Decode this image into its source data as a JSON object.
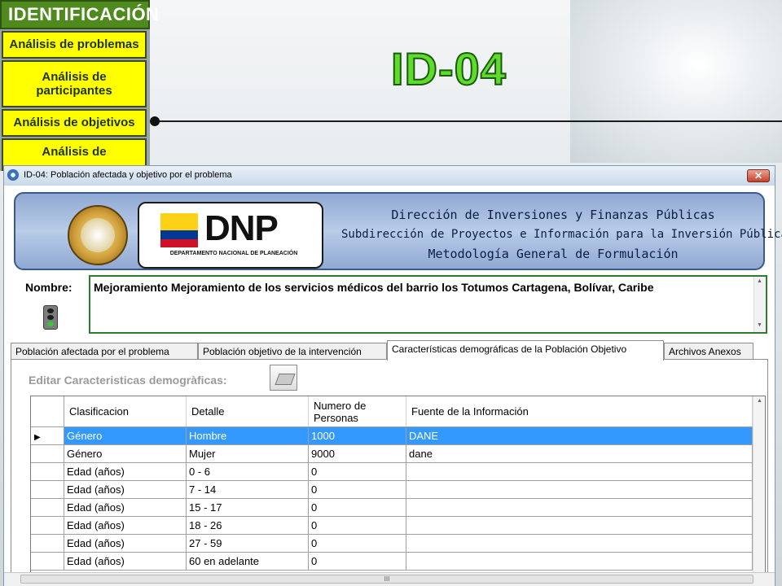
{
  "slide": {
    "id_title": "ID-04",
    "nav": {
      "title": "IDENTIFICACIÓN",
      "items": [
        "Análisis de problemas",
        "Análisis de participantes",
        "Análisis de objetivos",
        "Análisis de"
      ]
    }
  },
  "window": {
    "title": "ID-04: Población afectada y objetivo por el problema",
    "close_symbol": "✕"
  },
  "banner": {
    "seal_text": "REPÚBLICA DE COLOMBIA",
    "dnp_logo": "DNP",
    "dnp_subtitle": "DEPARTAMENTO NACIONAL DE PLANEACIÓN",
    "lines": [
      "Dirección de Inversiones y Finanzas Públicas",
      "Subdirección de Proyectos e Información para la Inversión Pública",
      "Metodología General de Formulación"
    ]
  },
  "nombre": {
    "label": "Nombre:",
    "value": "Mejoramiento Mejoramiento de los servicios médicos del barrio los Totumos Cartagena, Bolívar, Caribe"
  },
  "tabs": [
    {
      "label": "Población afectada por el problema",
      "active": false
    },
    {
      "label": "Población objetivo de la intervención",
      "active": false
    },
    {
      "label": "Características demográficas de la Población Objetivo",
      "active": true
    },
    {
      "label": "Archivos Anexos",
      "active": false
    }
  ],
  "edit": {
    "label": "Editar Caracteristicas demogràficas:",
    "button_icon": "pencil-icon"
  },
  "grid": {
    "columns": [
      "Clasificacion",
      "Detalle",
      "Numero de Personas",
      "Fuente de la Información"
    ],
    "rows": [
      {
        "clasificacion": "Género",
        "detalle": "Hombre",
        "numero": "1000",
        "fuente": "DANE",
        "selected": true
      },
      {
        "clasificacion": "Género",
        "detalle": "Mujer",
        "numero": "9000",
        "fuente": "dane",
        "selected": false
      },
      {
        "clasificacion": "Edad (años)",
        "detalle": "0 - 6",
        "numero": "0",
        "fuente": "",
        "selected": false
      },
      {
        "clasificacion": "Edad (años)",
        "detalle": "7 - 14",
        "numero": "0",
        "fuente": "",
        "selected": false
      },
      {
        "clasificacion": "Edad (años)",
        "detalle": "15 - 17",
        "numero": "0",
        "fuente": "",
        "selected": false
      },
      {
        "clasificacion": "Edad (años)",
        "detalle": "18 - 26",
        "numero": "0",
        "fuente": "",
        "selected": false
      },
      {
        "clasificacion": "Edad (años)",
        "detalle": "27 - 59",
        "numero": "0",
        "fuente": "",
        "selected": false
      },
      {
        "clasificacion": "Edad (años)",
        "detalle": "60 en adelante",
        "numero": "0",
        "fuente": "",
        "selected": false
      }
    ],
    "row_arrow": "▶"
  },
  "hscroll_grip": "III",
  "colors": {
    "selection": "#3399ff",
    "nav_button": "#ffff00",
    "nav_title": "#4f8a1e",
    "nombre_border": "#2f7a2f",
    "id_title": "#5edc2a"
  }
}
